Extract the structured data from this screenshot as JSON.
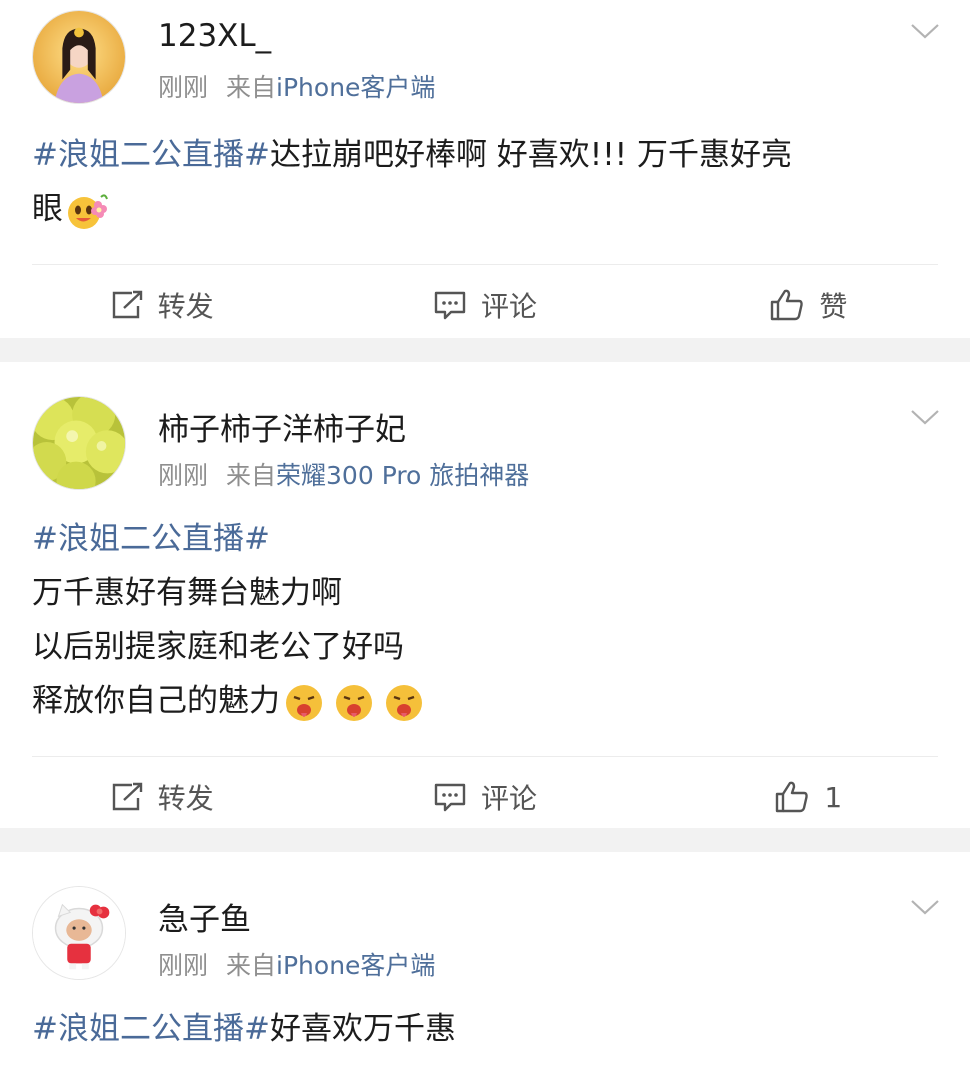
{
  "posts": [
    {
      "username": "123XL_",
      "time": "刚刚",
      "from_label": "来自",
      "source": "iPhone客户端",
      "topic": "#浪姐二公直播#",
      "lines": [
        "达拉崩吧好棒啊 好喜欢!!! 万千惠好亮",
        "眼"
      ],
      "emoji": "flower-face-emoji",
      "actions": {
        "repost": "转发",
        "comment": "评论",
        "like": "赞"
      }
    },
    {
      "username": "柿子柿子洋柿子妃",
      "time": "刚刚",
      "from_label": "来自",
      "source": "荣耀300 Pro 旅拍神器",
      "topic": "#浪姐二公直播#",
      "lines": [
        "万千惠好有舞台魅力啊",
        "以后别提家庭和老公了好吗",
        "释放你自己的魅力"
      ],
      "emoji": "drooling-face-emoji",
      "actions": {
        "repost": "转发",
        "comment": "评论",
        "like": "1"
      }
    },
    {
      "username": "急子鱼",
      "time": "刚刚",
      "from_label": "来自",
      "source": "iPhone客户端",
      "topic": "#浪姐二公直播#",
      "lines": [
        "好喜欢万千惠"
      ]
    }
  ],
  "colors": {
    "topic": "#4a6a98",
    "meta": "#8f8f8f",
    "divider": "#ececec",
    "gap": "#f2f2f2"
  }
}
